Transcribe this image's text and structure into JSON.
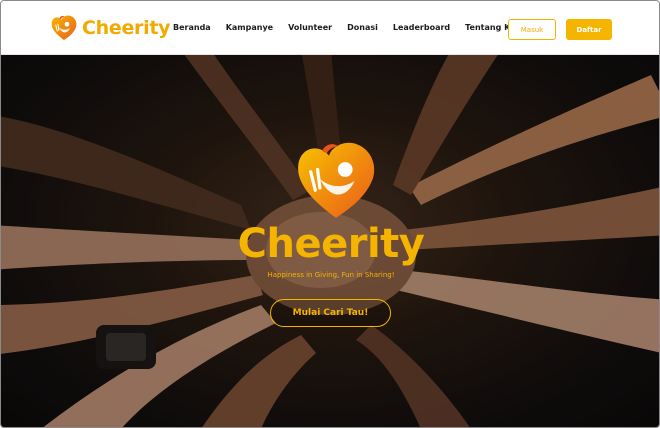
{
  "brand": {
    "name": "Cheerity",
    "logo_icon": "heart-flame-logo-icon",
    "color": "#f2a900"
  },
  "nav": {
    "items": [
      {
        "label": "Beranda"
      },
      {
        "label": "Kampanye"
      },
      {
        "label": "Volunteer"
      },
      {
        "label": "Donasi"
      },
      {
        "label": "Leaderboard"
      },
      {
        "label": "Tentang Kami"
      }
    ],
    "login_label": "Masuk",
    "register_label": "Daftar"
  },
  "hero": {
    "title": "Cheerity",
    "tagline": "Happiness in Giving, Fun in Sharing!",
    "cta_label": "Mulai Cari Tau!",
    "background": "photo of many hands stacked together"
  },
  "colors": {
    "accent": "#f5b400",
    "nav_text": "#1b1b1b",
    "hero_bg": "#141010"
  }
}
